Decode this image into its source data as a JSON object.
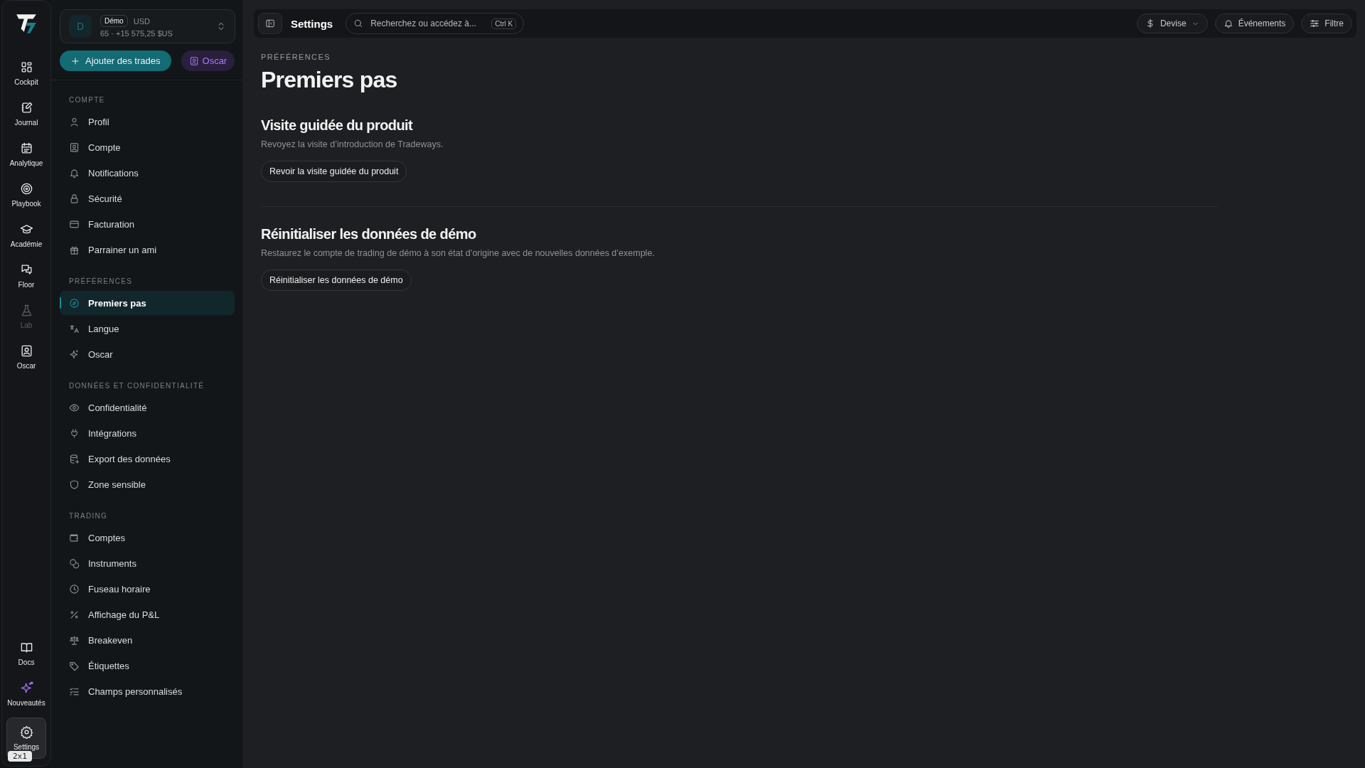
{
  "rail": {
    "items": [
      {
        "label": "Cockpit",
        "disabled": false,
        "selected": false
      },
      {
        "label": "Journal",
        "disabled": false,
        "selected": false
      },
      {
        "label": "Analytique",
        "disabled": false,
        "selected": false
      },
      {
        "label": "Playbook",
        "disabled": false,
        "selected": false
      },
      {
        "label": "Académie",
        "disabled": false,
        "selected": false
      },
      {
        "label": "Floor",
        "disabled": false,
        "selected": false
      },
      {
        "label": "Lab",
        "disabled": true,
        "selected": false
      },
      {
        "label": "Oscar",
        "disabled": false,
        "selected": false
      }
    ],
    "bottom_items": [
      {
        "label": "Docs",
        "selected": false
      },
      {
        "label": "Nouveautés",
        "selected": false
      },
      {
        "label": "Settings",
        "selected": true
      }
    ],
    "badge": "2x1"
  },
  "account": {
    "avatar": "D",
    "tag": "Démo",
    "currency": "USD",
    "summary": "65 · +15 575,25 $US"
  },
  "actions": {
    "add": "Ajouter des trades",
    "assistant": "Oscar"
  },
  "sidebar": {
    "sections": [
      {
        "title": "COMPTE",
        "items": [
          {
            "label": "Profil",
            "selected": false
          },
          {
            "label": "Compte",
            "selected": false
          },
          {
            "label": "Notifications",
            "selected": false
          },
          {
            "label": "Sécurité",
            "selected": false
          },
          {
            "label": "Facturation",
            "selected": false
          },
          {
            "label": "Parrainer un ami",
            "selected": false
          }
        ]
      },
      {
        "title": "PRÉFÉRENCES",
        "items": [
          {
            "label": "Premiers pas",
            "selected": true
          },
          {
            "label": "Langue",
            "selected": false
          },
          {
            "label": "Oscar",
            "selected": false
          }
        ]
      },
      {
        "title": "DONNÉES ET CONFIDENTIALITÉ",
        "items": [
          {
            "label": "Confidentialité",
            "selected": false
          },
          {
            "label": "Intégrations",
            "selected": false
          },
          {
            "label": "Export des données",
            "selected": false
          },
          {
            "label": "Zone sensible",
            "selected": false
          }
        ]
      },
      {
        "title": "TRADING",
        "items": [
          {
            "label": "Comptes",
            "selected": false
          },
          {
            "label": "Instruments",
            "selected": false
          },
          {
            "label": "Fuseau horaire",
            "selected": false
          },
          {
            "label": "Affichage du P&L",
            "selected": false
          },
          {
            "label": "Breakeven",
            "selected": false
          },
          {
            "label": "Étiquettes",
            "selected": false
          },
          {
            "label": "Champs personnalisés",
            "selected": false
          }
        ]
      }
    ]
  },
  "topbar": {
    "title": "Settings",
    "search": {
      "placeholder": "Recherchez ou accédez à...",
      "shortcut": "Ctrl K"
    },
    "buttons": [
      "Devise",
      "Événements",
      "Filtre"
    ]
  },
  "page": {
    "eyebrow": "PRÉFÉRENCES",
    "title": "Premiers pas",
    "sections": [
      {
        "heading": "Visite guidée du produit",
        "description": "Revoyez la visite d’introduction de Tradeways.",
        "button": "Revoir la visite guidée du produit"
      },
      {
        "heading": "Réinitialiser les données de démo",
        "description": "Restaurez le compte de trading de démo à son état d’origine avec de nouvelles données d’exemple.",
        "button": "Réinitialiser les données de démo"
      }
    ]
  }
}
